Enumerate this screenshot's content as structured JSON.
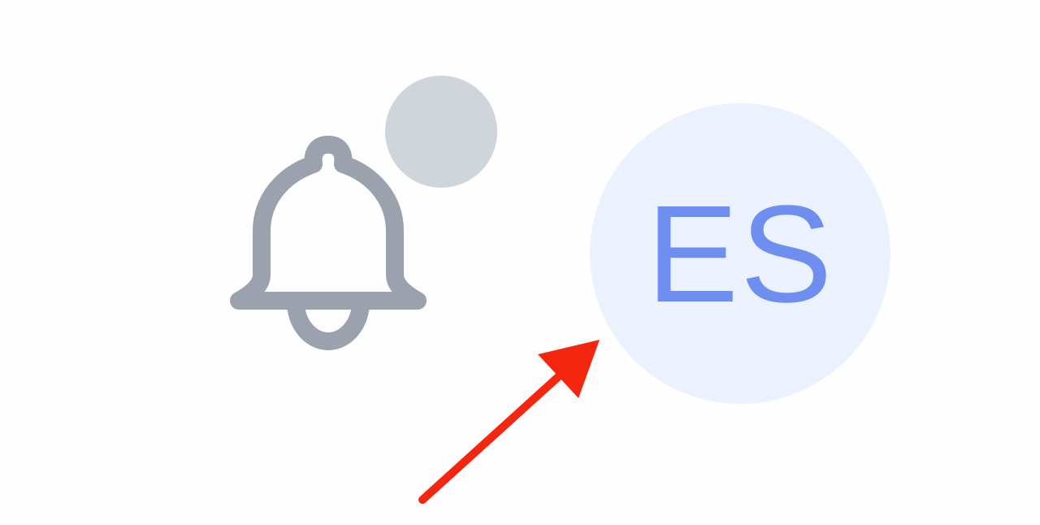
{
  "header": {
    "notifications": {
      "icon": "bell-icon",
      "icon_color": "#9ba1ad",
      "badge_color": "#d0d4db"
    },
    "user_avatar": {
      "initials": "ES",
      "background_color": "#ebf2fe",
      "text_color": "#6e8ff0"
    }
  },
  "annotation": {
    "icon": "red-arrow-icon",
    "color": "#f5260f"
  }
}
